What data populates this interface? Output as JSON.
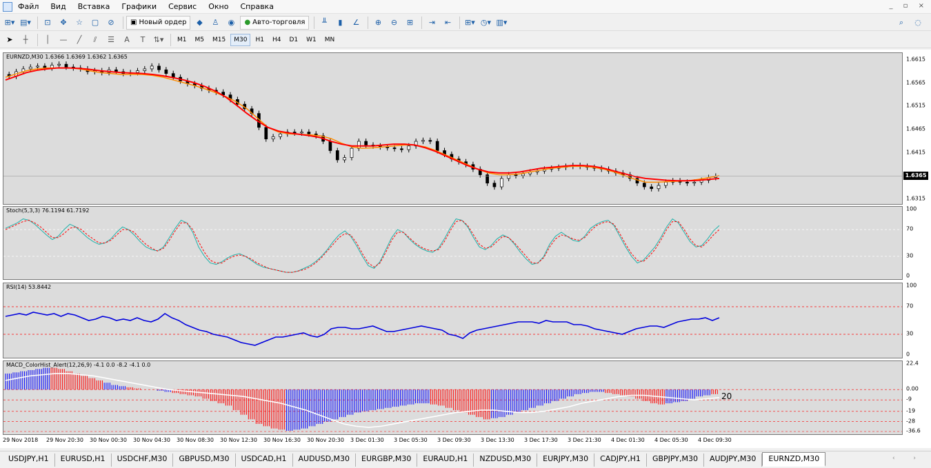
{
  "menu": [
    "Файл",
    "Вид",
    "Вставка",
    "Графики",
    "Сервис",
    "Окно",
    "Справка"
  ],
  "window_controls": "_ ▫ ×",
  "toolbar1": {
    "new_order": "Новый ордер",
    "autotrading": "Авто-торговля"
  },
  "timeframes": [
    "M1",
    "M5",
    "M15",
    "M30",
    "H1",
    "H4",
    "D1",
    "W1",
    "MN"
  ],
  "active_timeframe": "M30",
  "main_chart": {
    "label": "EURNZD,M30  1.6366 1.6369 1.6362 1.6365",
    "price_ticks": [
      "1.6615",
      "1.6565",
      "1.6515",
      "1.6465",
      "1.6415",
      "1.6315"
    ],
    "current_price": "1.6365",
    "price_min": 1.6305,
    "price_max": 1.663,
    "candles": [
      1.658,
      1.659,
      1.6596,
      1.66,
      1.6602,
      1.6598,
      1.6604,
      1.6606,
      1.66,
      1.6598,
      1.6596,
      1.659,
      1.6592,
      1.6588,
      1.6594,
      1.659,
      1.6586,
      1.6588,
      1.6592,
      1.6596,
      1.6602,
      1.6594,
      1.6586,
      1.6578,
      1.657,
      1.6564,
      1.656,
      1.6554,
      1.655,
      1.6546,
      1.654,
      1.653,
      1.652,
      1.651,
      1.65,
      1.647,
      1.6445,
      1.645,
      1.6456,
      1.646,
      1.6458,
      1.646,
      1.6456,
      1.6452,
      1.644,
      1.642,
      1.64,
      1.6405,
      1.6425,
      1.644,
      1.6432,
      1.643,
      1.6428,
      1.6426,
      1.6424,
      1.6422,
      1.643,
      1.644,
      1.6442,
      1.644,
      1.642,
      1.6412,
      1.6402,
      1.6396,
      1.639,
      1.638,
      1.6368,
      1.635,
      1.6342,
      1.636,
      1.6368,
      1.6366,
      1.637,
      1.6374,
      1.6376,
      1.638,
      1.6382,
      1.6384,
      1.6386,
      1.6388,
      1.6386,
      1.6384,
      1.6382,
      1.638,
      1.6376,
      1.6372,
      1.6368,
      1.636,
      1.635,
      1.6342,
      1.6338,
      1.6345,
      1.6352,
      1.6355,
      1.6352,
      1.635,
      1.6352,
      1.6356,
      1.6362,
      1.6365
    ],
    "ma_fast": [
      1.6578,
      1.6585,
      1.6592,
      1.6596,
      1.6598,
      1.6598,
      1.6598,
      1.6596,
      1.6592,
      1.6588,
      1.6586,
      1.6584,
      1.6584,
      1.6584,
      1.6582,
      1.6578,
      1.6572,
      1.6566,
      1.656,
      1.6553,
      1.6545,
      1.6536,
      1.6525,
      1.651,
      1.649,
      1.647,
      1.646,
      1.6456,
      1.6455,
      1.6454,
      1.6452,
      1.6446,
      1.6436,
      1.6428,
      1.6425,
      1.6426,
      1.6428,
      1.643,
      1.6432,
      1.6432,
      1.6428,
      1.642,
      1.641,
      1.64,
      1.639,
      1.638,
      1.6372,
      1.6368,
      1.6368,
      1.637,
      1.6374,
      1.6378,
      1.6382,
      1.6384,
      1.6386,
      1.6386,
      1.6384,
      1.638,
      1.6374,
      1.6366,
      1.6358,
      1.6352,
      1.6352,
      1.6353,
      1.6354,
      1.6355,
      1.6358,
      1.6362,
      1.6366
    ],
    "ma_slow": [
      1.6572,
      1.658,
      1.6588,
      1.6593,
      1.6596,
      1.6598,
      1.6598,
      1.6597,
      1.6595,
      1.6592,
      1.659,
      1.6588,
      1.6587,
      1.6586,
      1.6584,
      1.6581,
      1.6577,
      1.6572,
      1.6566,
      1.6558,
      1.6548,
      1.6535,
      1.6518,
      1.65,
      1.6484,
      1.647,
      1.6462,
      1.6458,
      1.6455,
      1.6452,
      1.6448,
      1.644,
      1.6434,
      1.643,
      1.643,
      1.643,
      1.6432,
      1.6434,
      1.6434,
      1.6432,
      1.6426,
      1.6418,
      1.6408,
      1.6398,
      1.6388,
      1.638,
      1.6374,
      1.6372,
      1.6372,
      1.6374,
      1.6378,
      1.6382,
      1.6384,
      1.6386,
      1.6388,
      1.6388,
      1.6386,
      1.6382,
      1.6376,
      1.637,
      1.6364,
      1.636,
      1.6358,
      1.6356,
      1.6355,
      1.6355,
      1.6356,
      1.6358,
      1.636
    ]
  },
  "stoch": {
    "label": "Stoch(5,3,3) 76.1194 61.7192",
    "ticks": [
      "100",
      "70",
      "30",
      "0"
    ],
    "main": [
      72,
      76,
      80,
      86,
      84,
      78,
      70,
      62,
      55,
      60,
      70,
      78,
      74,
      66,
      58,
      52,
      48,
      50,
      56,
      66,
      74,
      70,
      62,
      52,
      44,
      40,
      38,
      44,
      58,
      72,
      84,
      80,
      66,
      44,
      30,
      20,
      18,
      22,
      28,
      32,
      34,
      30,
      24,
      18,
      14,
      12,
      10,
      8,
      6,
      6,
      8,
      12,
      16,
      22,
      30,
      40,
      52,
      62,
      68,
      60,
      46,
      30,
      16,
      12,
      22,
      40,
      58,
      70,
      66,
      56,
      48,
      42,
      38,
      36,
      42,
      56,
      72,
      86,
      84,
      74,
      58,
      44,
      40,
      46,
      56,
      62,
      58,
      48,
      36,
      26,
      18,
      20,
      30,
      48,
      60,
      66,
      60,
      54,
      52,
      60,
      72,
      78,
      82,
      84,
      76,
      60,
      44,
      30,
      20,
      24,
      34,
      44,
      58,
      74,
      86,
      80,
      66,
      52,
      44,
      46,
      56,
      68,
      76
    ],
    "signal": [
      70,
      74,
      78,
      82,
      84,
      80,
      74,
      66,
      58,
      58,
      64,
      72,
      74,
      70,
      62,
      56,
      50,
      50,
      54,
      62,
      70,
      70,
      66,
      56,
      48,
      42,
      38,
      42,
      54,
      68,
      80,
      80,
      70,
      52,
      36,
      24,
      20,
      20,
      26,
      30,
      32,
      30,
      26,
      20,
      16,
      12,
      10,
      8,
      6,
      6,
      8,
      10,
      14,
      20,
      28,
      38,
      48,
      58,
      64,
      62,
      50,
      34,
      20,
      14,
      20,
      36,
      54,
      66,
      66,
      58,
      50,
      44,
      40,
      38,
      40,
      52,
      68,
      82,
      84,
      76,
      62,
      48,
      42,
      44,
      52,
      60,
      58,
      50,
      40,
      30,
      20,
      20,
      28,
      44,
      56,
      62,
      60,
      56,
      54,
      58,
      68,
      76,
      80,
      82,
      78,
      64,
      48,
      34,
      24,
      22,
      30,
      40,
      54,
      70,
      82,
      82,
      70,
      56,
      46,
      44,
      52,
      62,
      70
    ]
  },
  "rsi": {
    "label": "RSI(14) 53.8442",
    "ticks": [
      "100",
      "70",
      "30",
      "0"
    ],
    "values": [
      56,
      58,
      60,
      58,
      62,
      60,
      58,
      60,
      56,
      60,
      58,
      54,
      50,
      52,
      56,
      54,
      50,
      52,
      50,
      54,
      50,
      48,
      52,
      60,
      54,
      50,
      44,
      40,
      36,
      34,
      30,
      28,
      26,
      22,
      18,
      16,
      14,
      18,
      22,
      26,
      26,
      28,
      30,
      32,
      28,
      26,
      30,
      38,
      40,
      40,
      38,
      38,
      40,
      42,
      38,
      34,
      34,
      36,
      38,
      40,
      42,
      40,
      38,
      36,
      30,
      28,
      24,
      32,
      36,
      38,
      40,
      42,
      44,
      46,
      48,
      48,
      48,
      46,
      50,
      48,
      48,
      48,
      44,
      44,
      42,
      38,
      36,
      34,
      32,
      30,
      34,
      38,
      40,
      42,
      42,
      40,
      44,
      48,
      50,
      52,
      52,
      54
    ],
    "values_tail": [
      50,
      54
    ]
  },
  "macd": {
    "label": "MACD_ColorHist_Alert(12,26,9) -4.1 0.0 -8.2 -4.1 0.0",
    "ticks": [
      "22.4",
      "0.00",
      "-9",
      "-19",
      "-28",
      "-36.6"
    ],
    "tick_values": [
      22.4,
      0,
      -9,
      -19,
      -28,
      -36.6
    ],
    "value_label": "20",
    "hist": [
      14,
      15,
      16,
      17,
      18,
      19,
      19,
      18,
      16,
      14,
      12,
      10,
      8,
      6,
      4,
      3,
      2,
      1,
      0,
      0,
      -1,
      -2,
      -3,
      -4,
      -5,
      -6,
      -8,
      -10,
      -12,
      -14,
      -18,
      -22,
      -26,
      -30,
      -32,
      -34,
      -35,
      -36,
      -35,
      -34,
      -32,
      -30,
      -28,
      -26,
      -24,
      -22,
      -20,
      -19,
      -18,
      -17,
      -16,
      -15,
      -14,
      -13,
      -12,
      -12,
      -13,
      -14,
      -16,
      -18,
      -20,
      -22,
      -24,
      -26,
      -25,
      -24,
      -22,
      -20,
      -18,
      -16,
      -14,
      -12,
      -10,
      -8,
      -6,
      -4,
      -3,
      -2,
      -2,
      -3,
      -4,
      -5,
      -6,
      -8,
      -10,
      -12,
      -13,
      -12,
      -11,
      -10,
      -8,
      -6,
      -5,
      -4
    ],
    "hist_colors": [
      "b",
      "b",
      "b",
      "b",
      "b",
      "b",
      "r",
      "r",
      "r",
      "r",
      "r",
      "r",
      "r",
      "b",
      "b",
      "b",
      "r",
      "r",
      "r",
      "r",
      "b",
      "b",
      "r",
      "r",
      "r",
      "r",
      "r",
      "r",
      "r",
      "r",
      "r",
      "r",
      "r",
      "r",
      "r",
      "r",
      "r",
      "b",
      "b",
      "b",
      "b",
      "b",
      "b",
      "b",
      "b",
      "b",
      "b",
      "b",
      "b",
      "b",
      "b",
      "b",
      "b",
      "b",
      "b",
      "b",
      "r",
      "r",
      "r",
      "r",
      "r",
      "r",
      "r",
      "r",
      "b",
      "b",
      "b",
      "b",
      "b",
      "b",
      "b",
      "b",
      "b",
      "b",
      "b",
      "b",
      "b",
      "b",
      "b",
      "r",
      "r",
      "r",
      "r",
      "r",
      "r",
      "r",
      "r",
      "b",
      "b",
      "b",
      "b",
      "b",
      "b",
      "r"
    ],
    "signal": [
      8,
      10,
      12,
      13,
      14,
      14,
      13,
      12,
      10,
      8,
      6,
      4,
      2,
      0,
      -1,
      -2,
      -3,
      -4,
      -5,
      -6,
      -8,
      -10,
      -12,
      -15,
      -18,
      -22,
      -26,
      -30,
      -32,
      -33,
      -32,
      -30,
      -28,
      -26,
      -24,
      -22,
      -20,
      -19,
      -18,
      -18,
      -19,
      -20,
      -20,
      -19,
      -17,
      -15,
      -12,
      -10,
      -8,
      -6,
      -5,
      -5,
      -6,
      -7,
      -8,
      -9,
      -8,
      -7
    ]
  },
  "time_labels": [
    "29 Nov 2018",
    "29 Nov 20:30",
    "30 Nov 00:30",
    "30 Nov 04:30",
    "30 Nov 08:30",
    "30 Nov 12:30",
    "30 Nov 16:30",
    "30 Nov 20:30",
    "3 Dec 01:30",
    "3 Dec 05:30",
    "3 Dec 09:30",
    "3 Dec 13:30",
    "3 Dec 17:30",
    "3 Dec 21:30",
    "4 Dec 01:30",
    "4 Dec 05:30",
    "4 Dec 09:30"
  ],
  "tabs": [
    "USDJPY,H1",
    "EURUSD,H1",
    "USDCHF,M30",
    "GBPUSD,M30",
    "USDCAD,H1",
    "AUDUSD,M30",
    "EURGBP,M30",
    "EURAUD,H1",
    "NZDUSD,M30",
    "EURJPY,M30",
    "CADJPY,H1",
    "GBPJPY,M30",
    "AUDJPY,M30",
    "EURNZD,M30"
  ],
  "active_tab": "EURNZD,M30",
  "colors": {
    "ma_fast": "#ff8c00",
    "ma_slow": "#ff0000",
    "stoch_main": "#20b2aa",
    "stoch_signal": "#ff0000",
    "rsi": "#0000dd",
    "hist_blue": "#0000ff",
    "hist_red": "#ff0000",
    "macd_signal": "#ffffff",
    "level": "#ff0000"
  }
}
